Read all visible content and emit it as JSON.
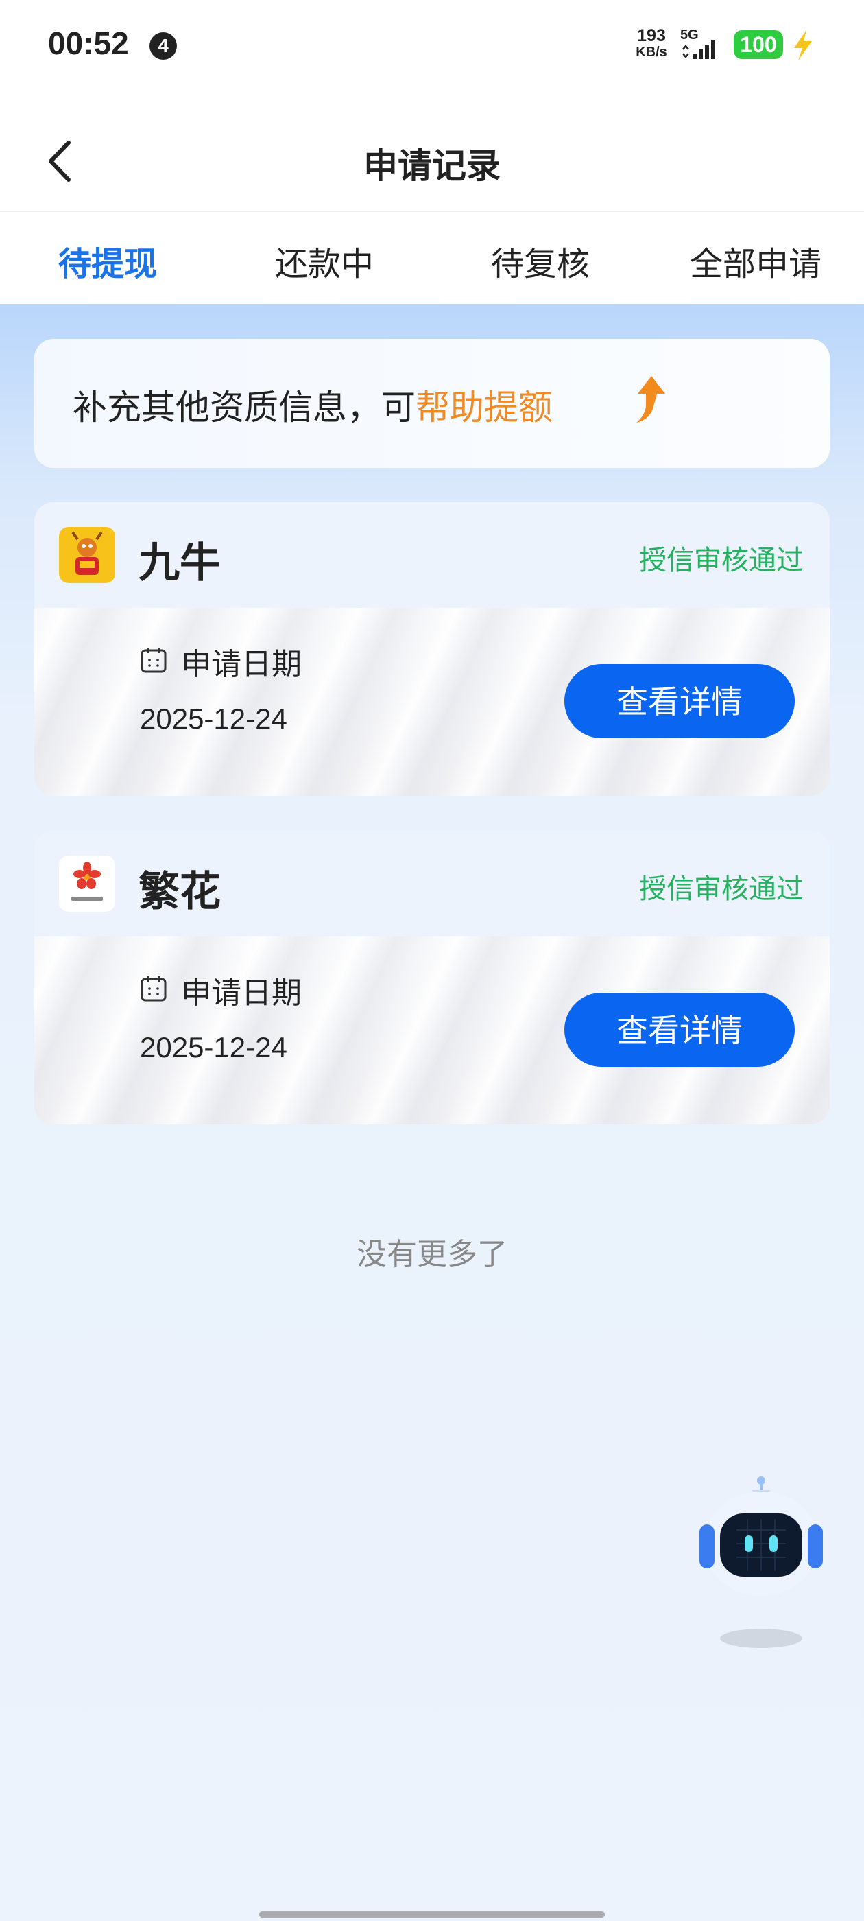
{
  "status_bar": {
    "time": "00:52",
    "notification_count": "4",
    "net_speed_value": "193",
    "net_speed_unit": "KB/s",
    "network_type": "5G",
    "battery": "100"
  },
  "header": {
    "title": "申请记录"
  },
  "tabs": [
    {
      "label": "待提现",
      "active": true
    },
    {
      "label": "还款中",
      "active": false
    },
    {
      "label": "待复核",
      "active": false
    },
    {
      "label": "全部申请",
      "active": false
    }
  ],
  "promo": {
    "text": "补充其他资质信息，可",
    "highlight": "帮助提额"
  },
  "applications": [
    {
      "name": "九牛",
      "status": "授信审核通过",
      "date_label": "申请日期",
      "date": "2025-12-24",
      "button_label": "查看详情",
      "logo": "jiuniu-logo"
    },
    {
      "name": "繁花",
      "status": "授信审核通过",
      "date_label": "申请日期",
      "date": "2025-12-24",
      "button_label": "查看详情",
      "logo": "fanhua-logo"
    }
  ],
  "footer": {
    "no_more_text": "没有更多了"
  },
  "colors": {
    "accent": "#1a73e8",
    "button": "#0a66f0",
    "status_green": "#25b160",
    "highlight_orange": "#f08a24"
  }
}
